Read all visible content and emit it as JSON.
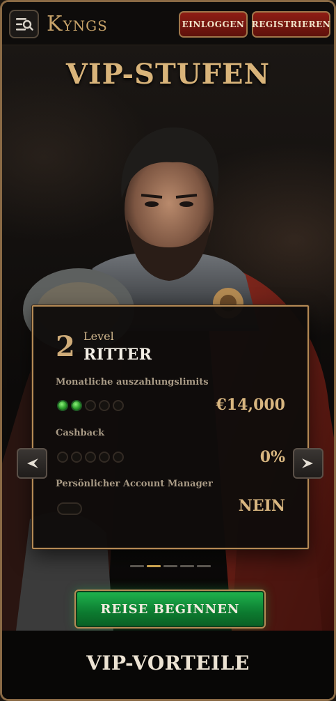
{
  "header": {
    "logo": {
      "initial": "K",
      "rest": "YNGS"
    },
    "login_label": "EINLOGGEN",
    "register_label": "REGISTRIEREN"
  },
  "hero": {
    "title": "VIP-STUFEN"
  },
  "vip_card": {
    "level_number": "2",
    "level_label": "Level",
    "level_name": "RITTER",
    "rows": [
      {
        "label": "Monatliche auszahlungslimits",
        "value": "€14,000",
        "indicator": "dots",
        "filled": 2,
        "total": 5
      },
      {
        "label": "Cashback",
        "value": "0%",
        "indicator": "dots",
        "filled": 0,
        "total": 5
      },
      {
        "label": "Persönlicher Account Manager",
        "value": "NEIN",
        "indicator": "pill",
        "filled": 0,
        "total": 1
      }
    ]
  },
  "carousel": {
    "pages": 5,
    "active_index": 1
  },
  "cta": {
    "label": "REISE BEGINNEN"
  },
  "bottom_section": {
    "title": "VIP-VORTEILE"
  },
  "colors": {
    "accent_gold": "#d9b47a",
    "button_red": "#8e1d14",
    "cta_green": "#1fb54f",
    "active_dot_green": "#2e9e2c",
    "frame": "#8a6a45"
  },
  "icons": {
    "menu": "search-menu-icon",
    "prev": "chevron-left-icon",
    "next": "chevron-right-icon"
  }
}
